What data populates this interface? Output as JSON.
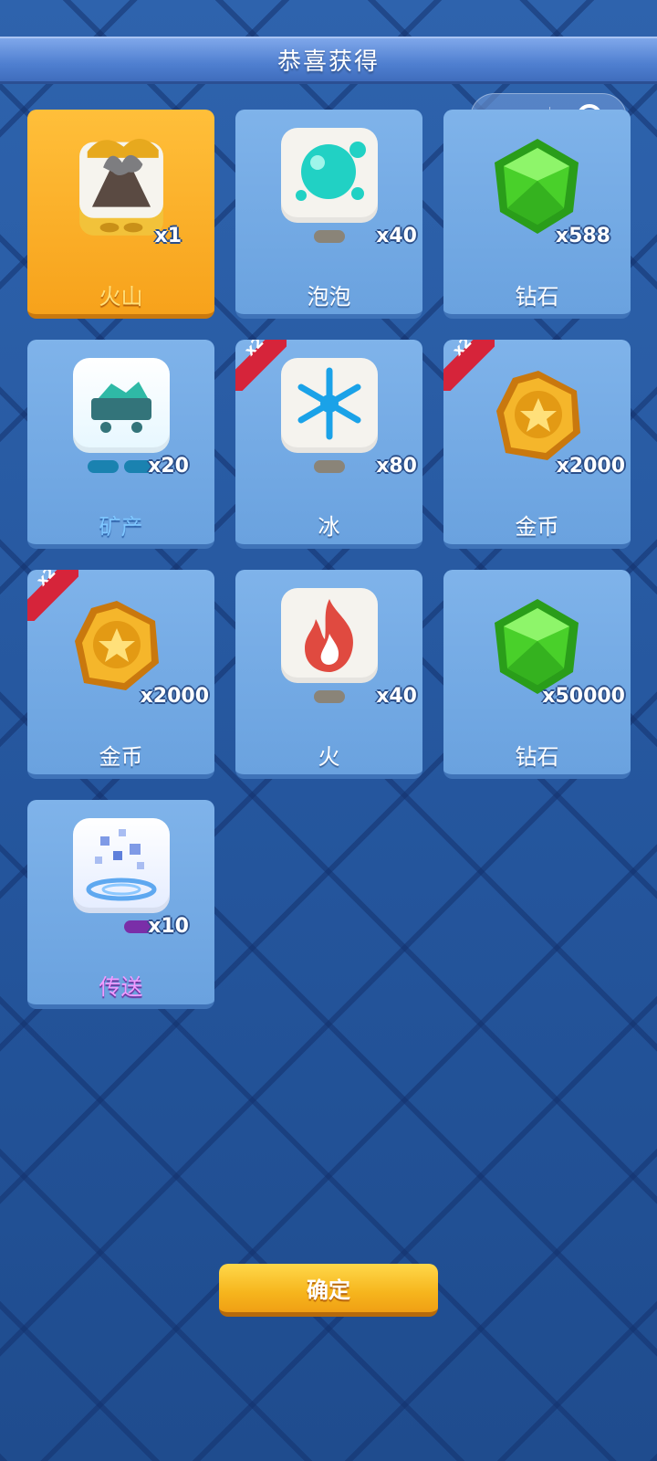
{
  "header": {
    "title": "恭喜获得"
  },
  "capsule": {
    "more_icon": "more-dots-icon",
    "close_icon": "target-close-icon"
  },
  "rewards": [
    {
      "name": "火山",
      "count": "x1",
      "icon": "volcano-dice-icon",
      "highlight": true
    },
    {
      "name": "泡泡",
      "count": "x40",
      "icon": "bubble-dice-icon"
    },
    {
      "name": "钻石",
      "count": "x588",
      "icon": "green-diamond-icon"
    },
    {
      "name": "矿产",
      "count": "x20",
      "icon": "mine-cart-dice-icon"
    },
    {
      "name": "冰",
      "count": "x80",
      "icon": "snowflake-dice-icon",
      "multiplier": "x2"
    },
    {
      "name": "金币",
      "count": "x2000",
      "icon": "gold-coin-icon",
      "multiplier": "x2"
    },
    {
      "name": "金币",
      "count": "x2000",
      "icon": "gold-coin-icon",
      "multiplier": "x2"
    },
    {
      "name": "火",
      "count": "x40",
      "icon": "fire-dice-icon"
    },
    {
      "name": "钻石",
      "count": "x50000",
      "icon": "green-diamond-icon"
    },
    {
      "name": "传送",
      "count": "x10",
      "icon": "teleport-dice-icon"
    }
  ],
  "confirm_button": {
    "label": "确定"
  },
  "colors": {
    "highlight": "#f7a21b",
    "card": "#6aa2df",
    "badge": "#d6243a",
    "button": "#f6b51d"
  }
}
